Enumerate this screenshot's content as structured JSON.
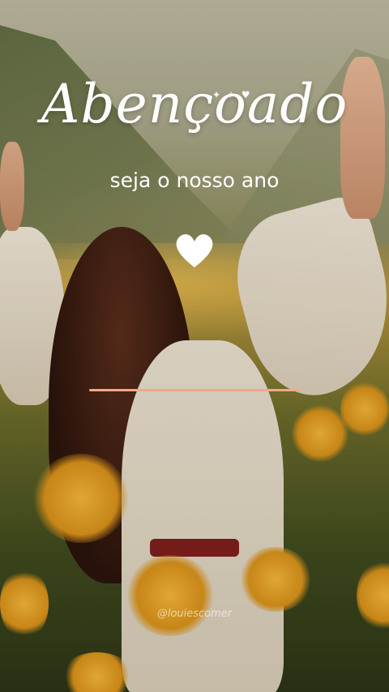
{
  "title": "Abençoado",
  "subtitle": "seja o nosso ano",
  "watermark": "@louiescomer",
  "colors": {
    "text": "#ffffff",
    "divider": "#f0a88a",
    "heart": "#ffffff"
  },
  "icons": {
    "heart": "heart-icon",
    "sparkles": "sparkle-icon"
  }
}
